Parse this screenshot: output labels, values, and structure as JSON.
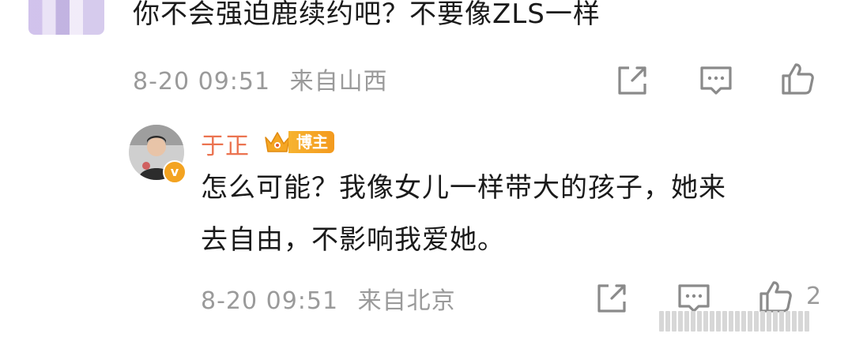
{
  "comment": {
    "text": "你不会强迫鹿续约吧？不要像ZLS一样",
    "time": "8-20 09:51",
    "location": "来自山西",
    "icons": [
      "share-icon",
      "reply-comment-icon",
      "like-icon"
    ]
  },
  "reply": {
    "author": "于正",
    "badge": "博主",
    "text_line1": "怎么可能？我像女儿一样带大的孩子，她来",
    "text_line2": "去自由，不影响我爱她。",
    "time": "8-20 09:51",
    "location": "来自北京",
    "like_count": "2",
    "verified_mark": "v",
    "icons": [
      "share-icon",
      "reply-comment-icon",
      "like-icon"
    ]
  },
  "colors": {
    "author": "#eb7350",
    "meta": "#9a9a9a",
    "text": "#1a1a1a",
    "badge": "#f3a321"
  }
}
